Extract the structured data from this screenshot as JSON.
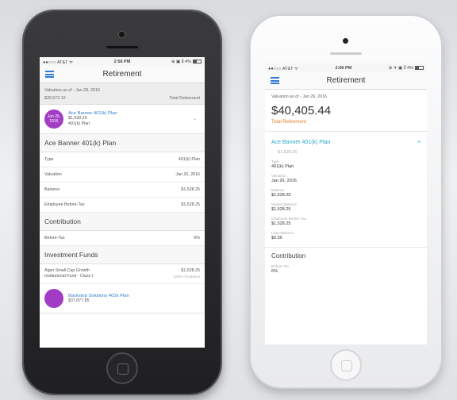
{
  "left_phone": {
    "status": {
      "carrier": "●●○○○ AT&T ᯤ",
      "time": "2:56 PM",
      "right": "⊕ ▣ ⁑ 4%"
    },
    "title": "Retirement",
    "summary": {
      "valuation": "Valuation as of - Jan 26, 2016",
      "amount": "$39,572.10",
      "total_label": "Total Retirement"
    },
    "plan_card": {
      "date_line1": "Jan 26,",
      "date_line2": "2016",
      "name": "Ace Banner 401(k) Plan",
      "balance": "$1,528.25",
      "type": "401(k) Plan"
    },
    "detail_title": "Ace Banner 401(k) Plan",
    "details": [
      {
        "label": "Type",
        "value": "401(k) Plan"
      },
      {
        "label": "Valuation",
        "value": "Jan 26, 2016"
      },
      {
        "label": "Balance",
        "value": "$1,528.25"
      },
      {
        "label": "Employee Before-Tax",
        "value": "$1,528.25"
      }
    ],
    "contribution_title": "Contribution",
    "contribution": {
      "label": "Before-Tax",
      "value": "6%"
    },
    "funds_title": "Investment Funds",
    "fund": {
      "name": "Alger Small Cap Growth",
      "name2": "Institutional Fund - Class I",
      "value": "$1,528.25",
      "sub": "100% of balance"
    },
    "plan_card2": {
      "name": "Backstop Solutions 401k Plan",
      "balance": "$37,877.85"
    }
  },
  "right_phone": {
    "status": {
      "carrier": "●●○○○ AT&T ᯤ",
      "time": "2:56 PM",
      "right": "⊕ ✈ ▣ ⁑ 4%"
    },
    "title": "Retirement",
    "valuation": "Valuation as of - Jan 26, 2016",
    "amount": "$40,405.44",
    "total_label": "Total Retirement",
    "plan": {
      "name": "Ace Banner 401(k) Plan",
      "value": "$1,528.25"
    },
    "fields": [
      {
        "label": "Type",
        "value": "401(k) Plan"
      },
      {
        "label": "Valuation",
        "value": "Jan 26, 2016"
      },
      {
        "label": "Balance",
        "value": "$1,528.25"
      },
      {
        "label": "Vested Balance",
        "value": "$1,528.25"
      },
      {
        "label": "Employee Before-Tax",
        "value": "$1,528.25"
      },
      {
        "label": "Loan Balance",
        "value": "$0.00"
      }
    ],
    "contribution_title": "Contribution",
    "contribution": {
      "label": "Before-Tax",
      "value": "6%"
    }
  },
  "colors": {
    "accent_blue": "#2f7bd0",
    "accent_teal": "#2aa7c6",
    "accent_orange": "#f07c2a",
    "badge_purple": "#a33cc4"
  },
  "icons": [
    "menu-icon",
    "chevron-down-icon",
    "chevron-up-icon",
    "battery-icon",
    "wifi-icon",
    "home-button-icon"
  ]
}
